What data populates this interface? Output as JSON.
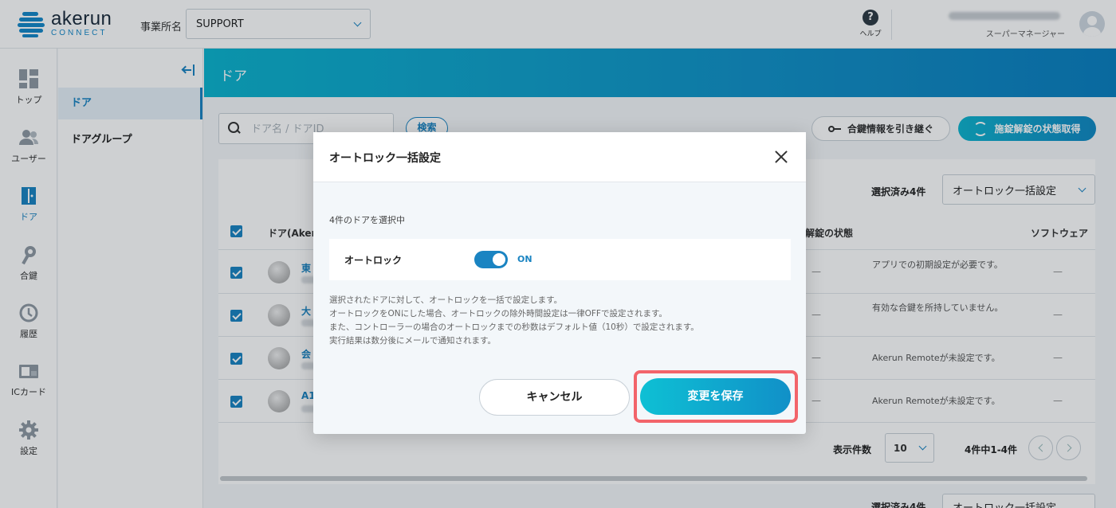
{
  "header": {
    "logo_main": "akerun",
    "logo_sub": "CONNECT",
    "office_label": "事業所名",
    "office_value": "SUPPORT",
    "help_label": "ヘルプ",
    "user_role": "スーパーマネージャー"
  },
  "rail": {
    "items": [
      {
        "label": "トップ",
        "icon": "dashboard-icon"
      },
      {
        "label": "ユーザー",
        "icon": "users-icon"
      },
      {
        "label": "ドア",
        "icon": "door-icon"
      },
      {
        "label": "合鍵",
        "icon": "key-icon"
      },
      {
        "label": "履歴",
        "icon": "history-icon"
      },
      {
        "label": "ICカード",
        "icon": "ic-card-icon"
      },
      {
        "label": "設定",
        "icon": "gear-icon"
      }
    ],
    "active": "ドア"
  },
  "subnav": {
    "items": [
      {
        "label": "ドア"
      },
      {
        "label": "ドアグループ"
      }
    ]
  },
  "main": {
    "title": "ドア",
    "search_placeholder": "ドア名 / ドアID",
    "search_button": "検索",
    "takeover_button": "合鍵情報を引き継ぐ",
    "status_button": "施錠解錠の状態取得",
    "selected_count": "選択済み4件",
    "bulk_action": "オートロック一括設定",
    "columns": [
      "ドア(Akeru",
      "解錠の状態",
      "ソフトウェア"
    ],
    "rows": [
      {
        "name": "東",
        "status": "—",
        "remark": "アプリでの初期設定が必要です。",
        "software": "—"
      },
      {
        "name": "大",
        "status": "—",
        "remark": "有効な合鍵を所持していません。",
        "software": "—"
      },
      {
        "name": "会",
        "status": "—",
        "remark": "Akerun Remoteが未設定です。",
        "software": "—"
      },
      {
        "name": "A1",
        "status": "—",
        "remark": "Akerun Remoteが未設定です。",
        "software": "—"
      }
    ],
    "pager_label": "表示件数",
    "pager_size": "10",
    "pager_range": "4件中1-4件"
  },
  "modal": {
    "title": "オートロック一括設定",
    "selection_info": "4件のドアを選択中",
    "toggle_label": "オートロック",
    "toggle_state": "ON",
    "description": [
      "選択されたドアに対して、オートロックを一括で設定します。",
      "オートロックをONにした場合、オートロックの除外時間設定は一律OFFで設定されます。",
      "また、コントローラーの場合のオートロックまでの秒数はデフォルト値（10秒）で設定されます。",
      "実行結果は数分後にメールで通知されます。"
    ],
    "cancel_label": "キャンセル",
    "save_label": "変更を保存"
  },
  "colors": {
    "accent": "#1a84c2",
    "banner_start": "#0cb4cf",
    "highlight": "#f2646a"
  }
}
